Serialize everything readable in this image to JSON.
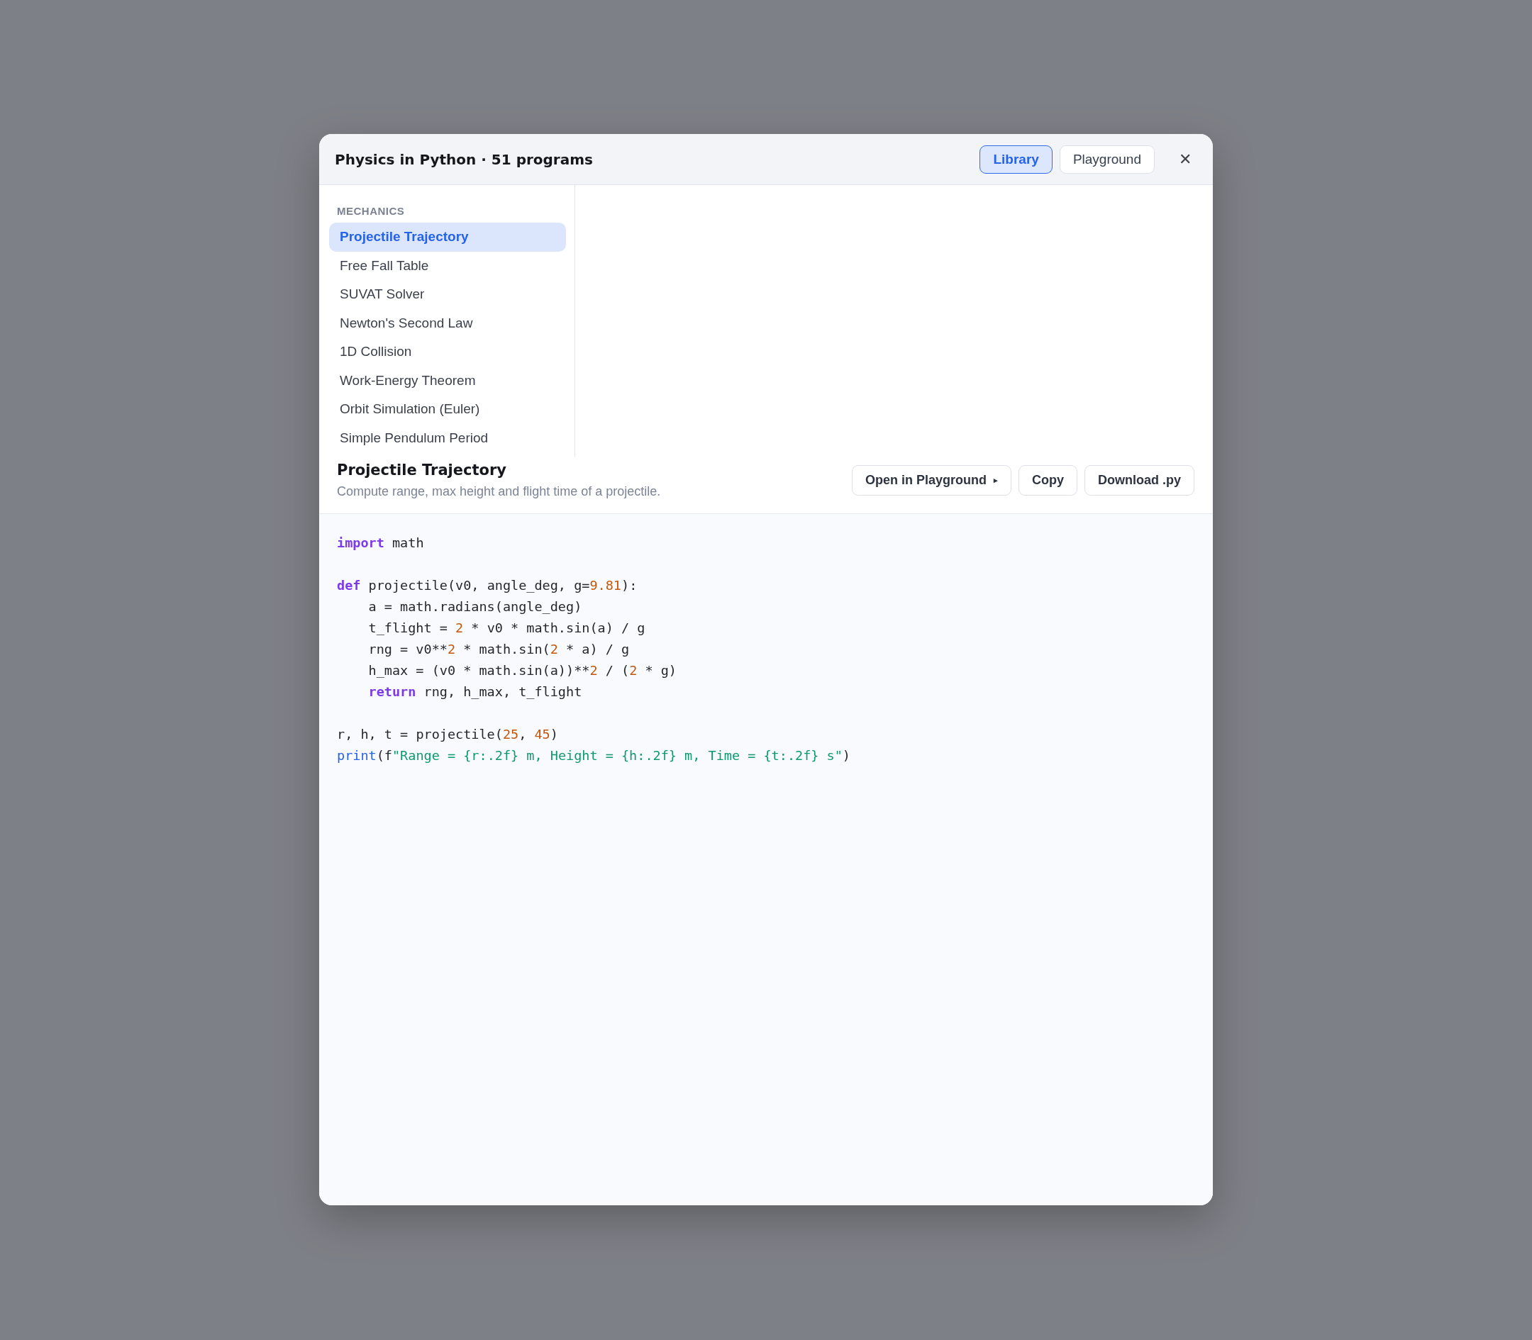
{
  "dialog": {
    "title": "Physics in Python · 51 programs",
    "tabs": [
      {
        "label": "Library",
        "selected": true
      },
      {
        "label": "Playground",
        "selected": false
      }
    ],
    "close": "✕"
  },
  "library": {
    "section": "MECHANICS",
    "items": [
      {
        "label": "Projectile Trajectory",
        "selected": true
      },
      {
        "label": "Free Fall Table",
        "selected": false
      },
      {
        "label": "SUVAT Solver",
        "selected": false
      },
      {
        "label": "Newton's Second Law",
        "selected": false
      },
      {
        "label": "1D Collision",
        "selected": false
      },
      {
        "label": "Work-Energy Theorem",
        "selected": false
      },
      {
        "label": "Orbit Simulation (Euler)",
        "selected": false
      },
      {
        "label": "Simple Pendulum Period",
        "selected": false
      }
    ]
  },
  "program": {
    "title": "Projectile Trajectory",
    "description": "Compute range, max height and flight time of a projectile.",
    "buttons": [
      {
        "label": "Open in Playground",
        "caret": "▸"
      },
      {
        "label": "Copy"
      },
      {
        "label": "Download .py"
      }
    ],
    "code": [
      {
        "kind": "line",
        "indent": false,
        "tokens": [
          {
            "kind": "kw",
            "text": "import"
          },
          {
            "kind": "plain",
            "text": " math"
          }
        ]
      },
      {
        "kind": "blank"
      },
      {
        "kind": "line",
        "indent": false,
        "tokens": [
          {
            "kind": "kw",
            "text": "def"
          },
          {
            "kind": "plain",
            "text": " projectile(v0, angle_deg, g="
          },
          {
            "kind": "num",
            "text": "9.81"
          },
          {
            "kind": "plain",
            "text": "):"
          }
        ]
      },
      {
        "kind": "line",
        "indent": true,
        "tokens": [
          {
            "kind": "plain",
            "text": "a = math.radians(angle_deg)"
          }
        ]
      },
      {
        "kind": "line",
        "indent": true,
        "tokens": [
          {
            "kind": "plain",
            "text": "t_flight = "
          },
          {
            "kind": "num",
            "text": "2"
          },
          {
            "kind": "plain",
            "text": " * v0 * math.sin(a) / g"
          }
        ]
      },
      {
        "kind": "line",
        "indent": true,
        "tokens": [
          {
            "kind": "plain",
            "text": "rng = v0**"
          },
          {
            "kind": "num",
            "text": "2"
          },
          {
            "kind": "plain",
            "text": " * math.sin("
          },
          {
            "kind": "num",
            "text": "2"
          },
          {
            "kind": "plain",
            "text": " * a) / g"
          }
        ]
      },
      {
        "kind": "line",
        "indent": true,
        "tokens": [
          {
            "kind": "plain",
            "text": "h_max = (v0 * math.sin(a))**"
          },
          {
            "kind": "num",
            "text": "2"
          },
          {
            "kind": "plain",
            "text": " / ("
          },
          {
            "kind": "num",
            "text": "2"
          },
          {
            "kind": "plain",
            "text": " * g)"
          }
        ]
      },
      {
        "kind": "line",
        "indent": true,
        "tokens": [
          {
            "kind": "kw",
            "text": "return"
          },
          {
            "kind": "plain",
            "text": " rng, h_max, t_flight"
          }
        ]
      },
      {
        "kind": "blank"
      },
      {
        "kind": "line",
        "indent": false,
        "tokens": [
          {
            "kind": "plain",
            "text": "r, h, t = projectile("
          },
          {
            "kind": "num",
            "text": "25"
          },
          {
            "kind": "plain",
            "text": ", "
          },
          {
            "kind": "num",
            "text": "45"
          },
          {
            "kind": "plain",
            "text": ")"
          }
        ]
      },
      {
        "kind": "line",
        "indent": false,
        "tokens": [
          {
            "kind": "fn",
            "text": "print"
          },
          {
            "kind": "plain",
            "text": "(f"
          },
          {
            "kind": "str",
            "text": "\"Range = {r:.2f} m, Height = {h:.2f} m, Time = {t:.2f} s\""
          },
          {
            "kind": "plain",
            "text": ")"
          }
        ]
      }
    ]
  }
}
